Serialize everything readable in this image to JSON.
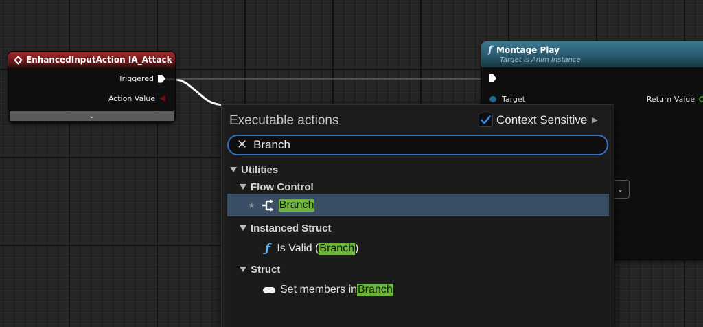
{
  "graph": {
    "event_node": {
      "title": "EnhancedInputAction IA_Attack",
      "pins": [
        "Triggered",
        "Action Value"
      ]
    },
    "montage_node": {
      "title": "Montage Play",
      "subtitle": "Target is Anim Instance",
      "target_label": "Target",
      "return_label": "Return Value"
    }
  },
  "menu": {
    "title": "Executable actions",
    "context_sensitive_label": "Context Sensitive",
    "context_sensitive_checked": true,
    "search": {
      "value": "Branch"
    },
    "results": [
      {
        "kind": "category",
        "label": "Utilities",
        "level": 0
      },
      {
        "kind": "category",
        "label": "Flow Control",
        "level": 1
      },
      {
        "kind": "action",
        "icon": "branch-icon",
        "pre": "",
        "match": "Branch",
        "post": "",
        "selected": true
      },
      {
        "kind": "category",
        "label": "Instanced Struct",
        "level": 1
      },
      {
        "kind": "action",
        "icon": "function-icon",
        "pre": "Is Valid (",
        "match": "Branch",
        "post": ")",
        "selected": false
      },
      {
        "kind": "category",
        "label": "Struct",
        "level": 1
      },
      {
        "kind": "action",
        "icon": "struct-pill-icon",
        "pre": "Set members in ",
        "match": "Branch",
        "post": "",
        "selected": false
      }
    ]
  },
  "colors": {
    "accent": "#2f73c9",
    "highlight": "#6cb53a",
    "selected_row": "#3a4f66",
    "event_header": "#a12a2a",
    "function_header": "#3d7a92"
  }
}
